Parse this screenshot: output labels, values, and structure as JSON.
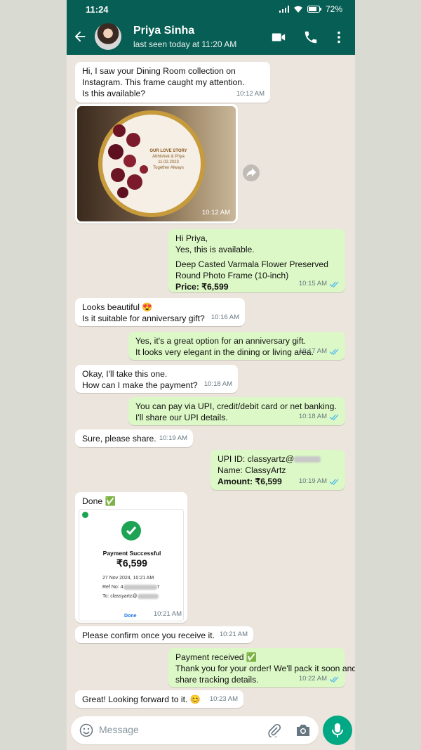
{
  "status_bar": {
    "time": "11:24",
    "battery": "72%"
  },
  "contact": {
    "name": "Priya Sinha",
    "last_seen": "last seen today at 11:20 AM"
  },
  "messages": [
    {
      "dir": "in",
      "lines": [
        "Hi, I saw your Dining Room collection on",
        "Instagram. This frame caught my attention.",
        "Is this available?"
      ],
      "time": "10:12 AM"
    },
    {
      "dir": "in",
      "type": "image",
      "image_text": [
        "OUR LOVE STORY",
        "Abhishek & Priya",
        "11.02.2023",
        "Together Always"
      ],
      "time": "10:12 AM"
    },
    {
      "dir": "out",
      "lines": [
        "Hi Priya,",
        "Yes, this is available."
      ],
      "lines2": [
        "Deep Casted Varmala Flower Preserved",
        "Round Photo Frame (10-inch)"
      ],
      "price_label": "Price: ₹6,599",
      "time": "10:15 AM"
    },
    {
      "dir": "in",
      "lines": [
        "Looks beautiful 😍",
        "Is it suitable for anniversary gift?"
      ],
      "time": "10:16 AM"
    },
    {
      "dir": "out",
      "lines": [
        "Yes, it's a great option for an anniversary gift.",
        "It looks very elegant in the dining or living area."
      ],
      "time": "10:17 AM"
    },
    {
      "dir": "in",
      "lines": [
        "Okay, I'll take this one.",
        "How can I make the payment?"
      ],
      "time": "10:18 AM"
    },
    {
      "dir": "out",
      "lines": [
        "You can pay via UPI, credit/debit card or net banking.",
        "I'll share our UPI details."
      ],
      "time": "10:18 AM"
    },
    {
      "dir": "in",
      "lines": [
        "Sure, please share."
      ],
      "time": "10:19 AM"
    },
    {
      "dir": "out",
      "upi_prefix": "UPI ID: classyartz@",
      "name_line": "Name: ClassyArtz",
      "amount_line": "Amount: ₹6,599",
      "time": "10:19 AM"
    },
    {
      "dir": "in",
      "type": "payment",
      "caption": "Done ✅",
      "receipt": {
        "title": "Payment Successful",
        "amount": "₹6,599",
        "date": "27 Nov 2024, 10:21 AM",
        "ref_prefix": "Ref No: 4",
        "ref_suffix": "7",
        "to_prefix": "To: classyartz@",
        "done_label": "Done"
      },
      "time": "10:21 AM"
    },
    {
      "dir": "in",
      "lines": [
        "Please confirm once you receive it."
      ],
      "time": "10:21 AM"
    },
    {
      "dir": "out",
      "lines": [
        "Payment received ✅",
        "Thank you for your order! We'll pack it soon and",
        "share tracking details."
      ],
      "time": "10:22 AM"
    },
    {
      "dir": "in",
      "lines": [
        "Great! Looking forward to it. 😊"
      ],
      "time": "10:23 AM"
    }
  ],
  "composer": {
    "placeholder": "Message"
  },
  "colors": {
    "header": "#075e54",
    "outgoing": "#dcf8c6",
    "incoming": "#ffffff",
    "mic": "#00a884",
    "read_ticks": "#53bdeb"
  }
}
